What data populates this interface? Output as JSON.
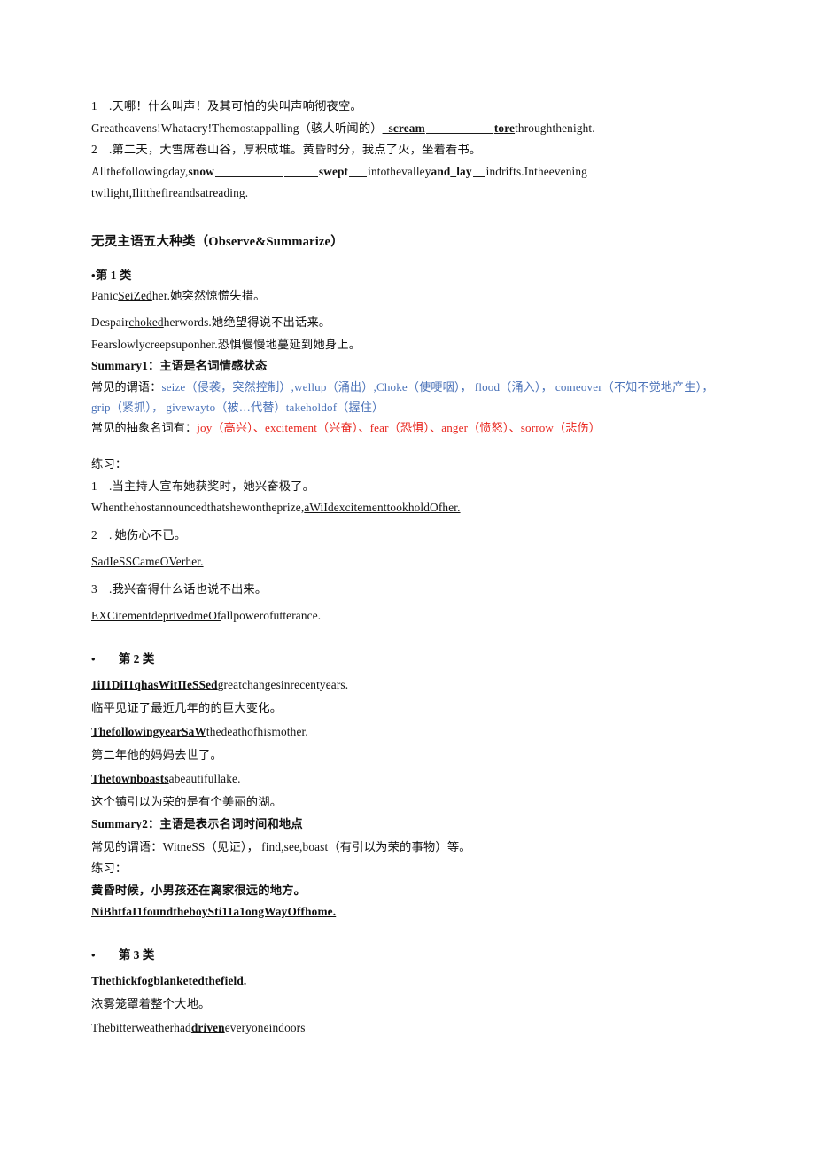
{
  "document": {
    "intro_items": [
      {
        "number": "1",
        "chinese": ".天哪！什么叫声！及其可怕的尖叫声响彻夜空。",
        "english_pre": "Greatheavens!Whatacry!Themostappalling（骇人听闻的）",
        "answer1": "_scream",
        "english_mid": "",
        "answer2": "tore",
        "english_post": "throughthenight."
      },
      {
        "number": "2",
        "chinese": ".第二天，大雪席卷山谷，厚积成堆。黄昏时分，我点了火，坐着看书。",
        "english_pre": "Allthefollowingday,",
        "answer1": "snow",
        "answer2": "swept",
        "english_mid": "intothevalley",
        "answer3": "and_lay",
        "english_post": "indrifts.Intheevening",
        "english_line2": "twilight,Ilitthefireandsatreading."
      }
    ],
    "main_heading": "无灵主语五大种类（Observe&Summarize）",
    "categories": [
      {
        "bullet": "•",
        "label": "第 1 类",
        "indent": false,
        "examples": [
          {
            "parts": [
              {
                "text": "Panic",
                "style": "plain"
              },
              {
                "text": "SeiZed",
                "style": "underline"
              },
              {
                "text": "her.她突然惊慌失措。",
                "style": "plain"
              }
            ]
          },
          {
            "parts": [
              {
                "text": "Despair",
                "style": "plain"
              },
              {
                "text": "choked",
                "style": "underline"
              },
              {
                "text": "herwords.她绝望得说不出话来。",
                "style": "plain"
              }
            ]
          },
          {
            "parts": [
              {
                "text": "Fearslowlycreepsuponher.恐惧慢慢地蔓延到她身上。",
                "style": "plain"
              }
            ]
          }
        ],
        "summary_label": "Summary1：主语是名词情感状态",
        "predicate_lead": "常见的谓语：",
        "predicate_text": "seize（侵袭，突然控制）,wellup（涌出）,Choke（使哽咽）， flood（涌入）， comeover（不知不觉地产生）， grip（紧抓）， givewayto（被…代替）takeholdof（握住）",
        "noun_lead": "常见的抽象名词有：",
        "noun_text": "joy（高兴）、excitement（兴奋）、fear（恐惧）、anger（愤怒）、sorrow（悲伤）",
        "practice_label": "练习：",
        "practice": [
          {
            "number": "1",
            "chinese": ".当主持人宣布她获奖时，她兴奋极了。",
            "answer_pre": "Whenthehostannouncedthatshewontheprize,",
            "answer": "aWiIdexcitementtookholdOfher."
          },
          {
            "number": "2",
            "chinese": ". 她伤心不已。",
            "answer_pre": "",
            "answer": "SadIeSSCameOVerher."
          },
          {
            "number": "3",
            "chinese": ".我兴奋得什么话也说不出来。",
            "answer_pre": "",
            "answer": "EXCitementdeprivedmeOf",
            "answer_post": "allpowerofutterance."
          }
        ]
      },
      {
        "bullet": "•",
        "label": "第 2 类",
        "indent": true,
        "examples": [
          {
            "parts": [
              {
                "text": "1iI1DiI1qhasWitIIeSSed",
                "style": "bold-underline"
              },
              {
                "text": "greatchangesinrecentyears.",
                "style": "plain"
              }
            ]
          },
          {
            "parts": [
              {
                "text": "临平见证了最近几年的的巨大变化。",
                "style": "plain"
              }
            ]
          },
          {
            "parts": [
              {
                "text": "ThefollowingyearSaW",
                "style": "bold-underline"
              },
              {
                "text": "thedeathofhismother.",
                "style": "plain"
              }
            ]
          },
          {
            "parts": [
              {
                "text": "第二年他的妈妈去世了。",
                "style": "plain"
              }
            ]
          },
          {
            "parts": [
              {
                "text": "Thetownboasts",
                "style": "bold-underline"
              },
              {
                "text": "abeautifullake.",
                "style": "plain"
              }
            ]
          },
          {
            "parts": [
              {
                "text": "这个镇引以为荣的是有个美丽的湖。",
                "style": "plain"
              }
            ]
          }
        ],
        "summary_label": "Summary2：主语是表示名词时间和地点",
        "predicate_lead": "常见的谓语：WitneSS（见证）， find,see,boast（有引以为荣的事物）等。",
        "practice_label": "练习：",
        "practice_chinese": "黄昏时候，小男孩还在离家很远的地方。",
        "practice_answer": "NiBhtfaI1foundtheboySti11a1ongWayOffhome."
      },
      {
        "bullet": "•",
        "label": "第 3 类",
        "indent": true,
        "examples": [
          {
            "parts": [
              {
                "text": "Thethickfogblanketedthefield.",
                "style": "bold-underline"
              }
            ]
          },
          {
            "parts": [
              {
                "text": "浓雾笼罩着整个大地。",
                "style": "plain"
              }
            ]
          },
          {
            "parts": [
              {
                "text": "Thebitterweatherhad",
                "style": "plain"
              },
              {
                "text": "driven",
                "style": "bold-underline"
              },
              {
                "text": "everyoneindoors",
                "style": "plain"
              }
            ]
          }
        ]
      }
    ]
  },
  "colors": {
    "blue": "#4a72b8",
    "red": "#e8241c",
    "text": "#111111",
    "background": "#ffffff"
  }
}
